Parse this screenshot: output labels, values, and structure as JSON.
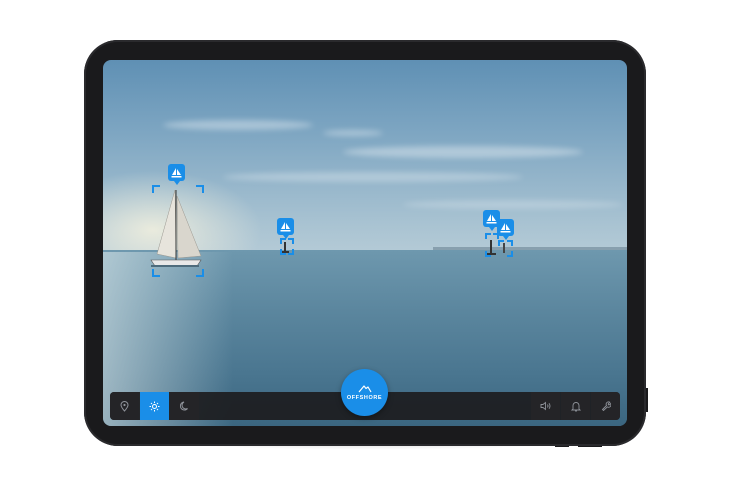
{
  "app": {
    "accent_color": "#1a8ee8",
    "mode_button": {
      "label": "OFFSHORE",
      "icon": "sail-mountain-icon"
    }
  },
  "toolbar": {
    "left_items": [
      {
        "name": "location",
        "icon": "location-pin-icon",
        "active": false
      },
      {
        "name": "day-mode",
        "icon": "sun-icon",
        "active": true
      },
      {
        "name": "night-mode",
        "icon": "moon-icon",
        "active": false
      }
    ],
    "right_items": [
      {
        "name": "sound",
        "icon": "speaker-icon"
      },
      {
        "name": "alerts",
        "icon": "bell-icon"
      },
      {
        "name": "settings",
        "icon": "wrench-icon"
      }
    ]
  },
  "detections": [
    {
      "id": "boat-1",
      "icon": "sailboat-icon"
    },
    {
      "id": "boat-2",
      "icon": "sailboat-icon"
    },
    {
      "id": "boat-3",
      "icon": "sailboat-icon"
    },
    {
      "id": "boat-4",
      "icon": "sailboat-icon"
    }
  ]
}
